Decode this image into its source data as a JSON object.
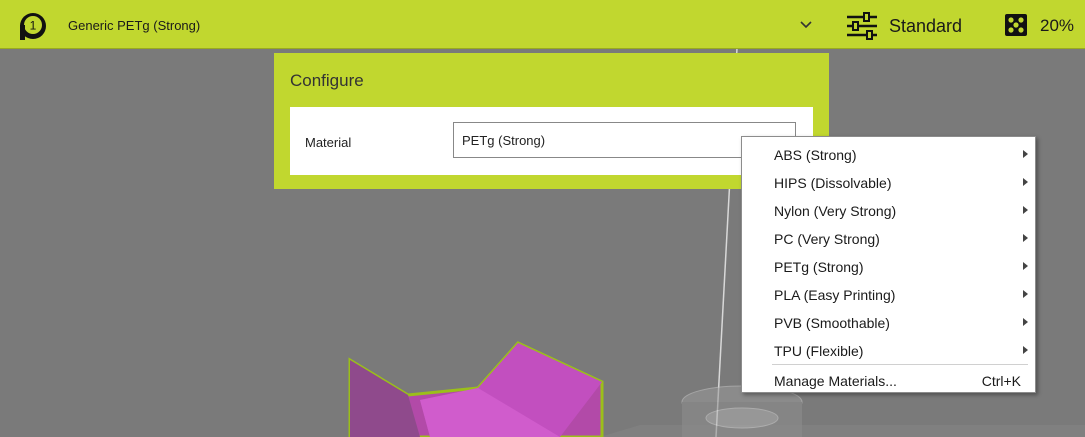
{
  "toolbar": {
    "extruder_number": "1",
    "material_name": "Generic PETg (Strong)",
    "profile_label": "Standard",
    "infill_label": "20%"
  },
  "configure": {
    "title": "Configure",
    "material_label": "Material",
    "material_value": "PETg (Strong)"
  },
  "menu": {
    "items": [
      {
        "label": "ABS (Strong)"
      },
      {
        "label": "HIPS (Dissolvable)"
      },
      {
        "label": "Nylon (Very Strong)"
      },
      {
        "label": "PC (Very Strong)"
      },
      {
        "label": "PETg (Strong)"
      },
      {
        "label": "PLA (Easy Printing)"
      },
      {
        "label": "PVB (Smoothable)"
      },
      {
        "label": "TPU (Flexible)"
      }
    ],
    "manage_label": "Manage Materials...",
    "manage_shortcut": "Ctrl+K"
  },
  "colors": {
    "accent": "#c1d72f",
    "model": "#c24fbf",
    "model_outline": "#9bbf1a",
    "viewport": "#7a7a7a"
  },
  "icons": {
    "extruder": "extruder-badge-icon",
    "profile": "settings-sliders-icon",
    "infill": "infill-pattern-icon"
  }
}
